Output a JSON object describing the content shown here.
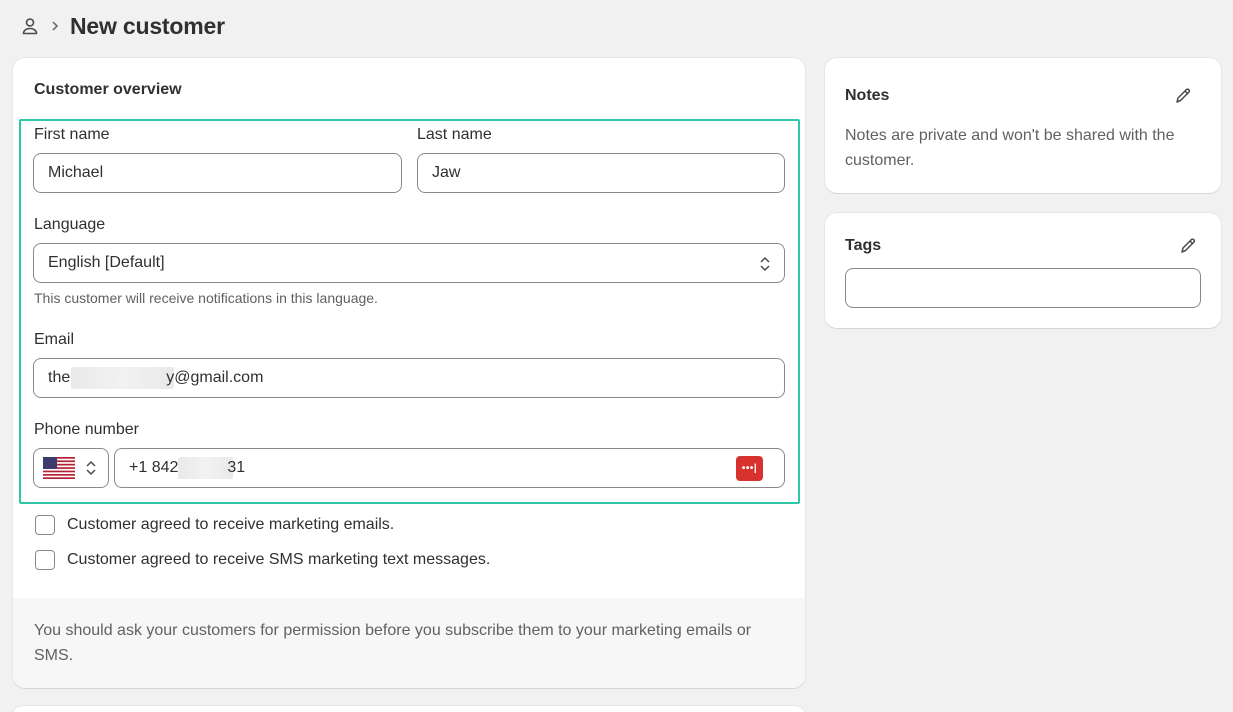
{
  "header": {
    "title": "New customer",
    "icon": "person-icon"
  },
  "customer_overview": {
    "heading": "Customer overview",
    "first_name": {
      "label": "First name",
      "value": "Michael"
    },
    "last_name": {
      "label": "Last name",
      "value": "Jaw"
    },
    "language": {
      "label": "Language",
      "value": "English [Default]",
      "help": "This customer will receive notifications in this language."
    },
    "email": {
      "label": "Email",
      "value_prefix": "the",
      "value_suffix": "y@gmail.com"
    },
    "phone": {
      "label": "Phone number",
      "country": "United States",
      "value_prefix": "+1 842",
      "value_suffix": "31"
    },
    "marketing_email": {
      "label": "Customer agreed to receive marketing emails.",
      "checked": false
    },
    "marketing_sms": {
      "label": "Customer agreed to receive SMS marketing text messages.",
      "checked": false
    },
    "permission_note": "You should ask your customers for permission before you subscribe them to your marketing emails or SMS."
  },
  "notes": {
    "heading": "Notes",
    "text": "Notes are private and won't be shared with the customer."
  },
  "tags": {
    "heading": "Tags",
    "value": ""
  },
  "colors": {
    "highlight": "#2fc7a6",
    "password_manager_badge": "#d8322f"
  }
}
